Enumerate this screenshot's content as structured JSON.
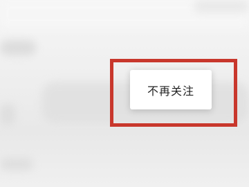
{
  "popup_menu": {
    "unfollow_label": "不再关注"
  },
  "colors": {
    "highlight": "#c8372c",
    "popup_background": "#ffffff",
    "text": "#222222"
  }
}
